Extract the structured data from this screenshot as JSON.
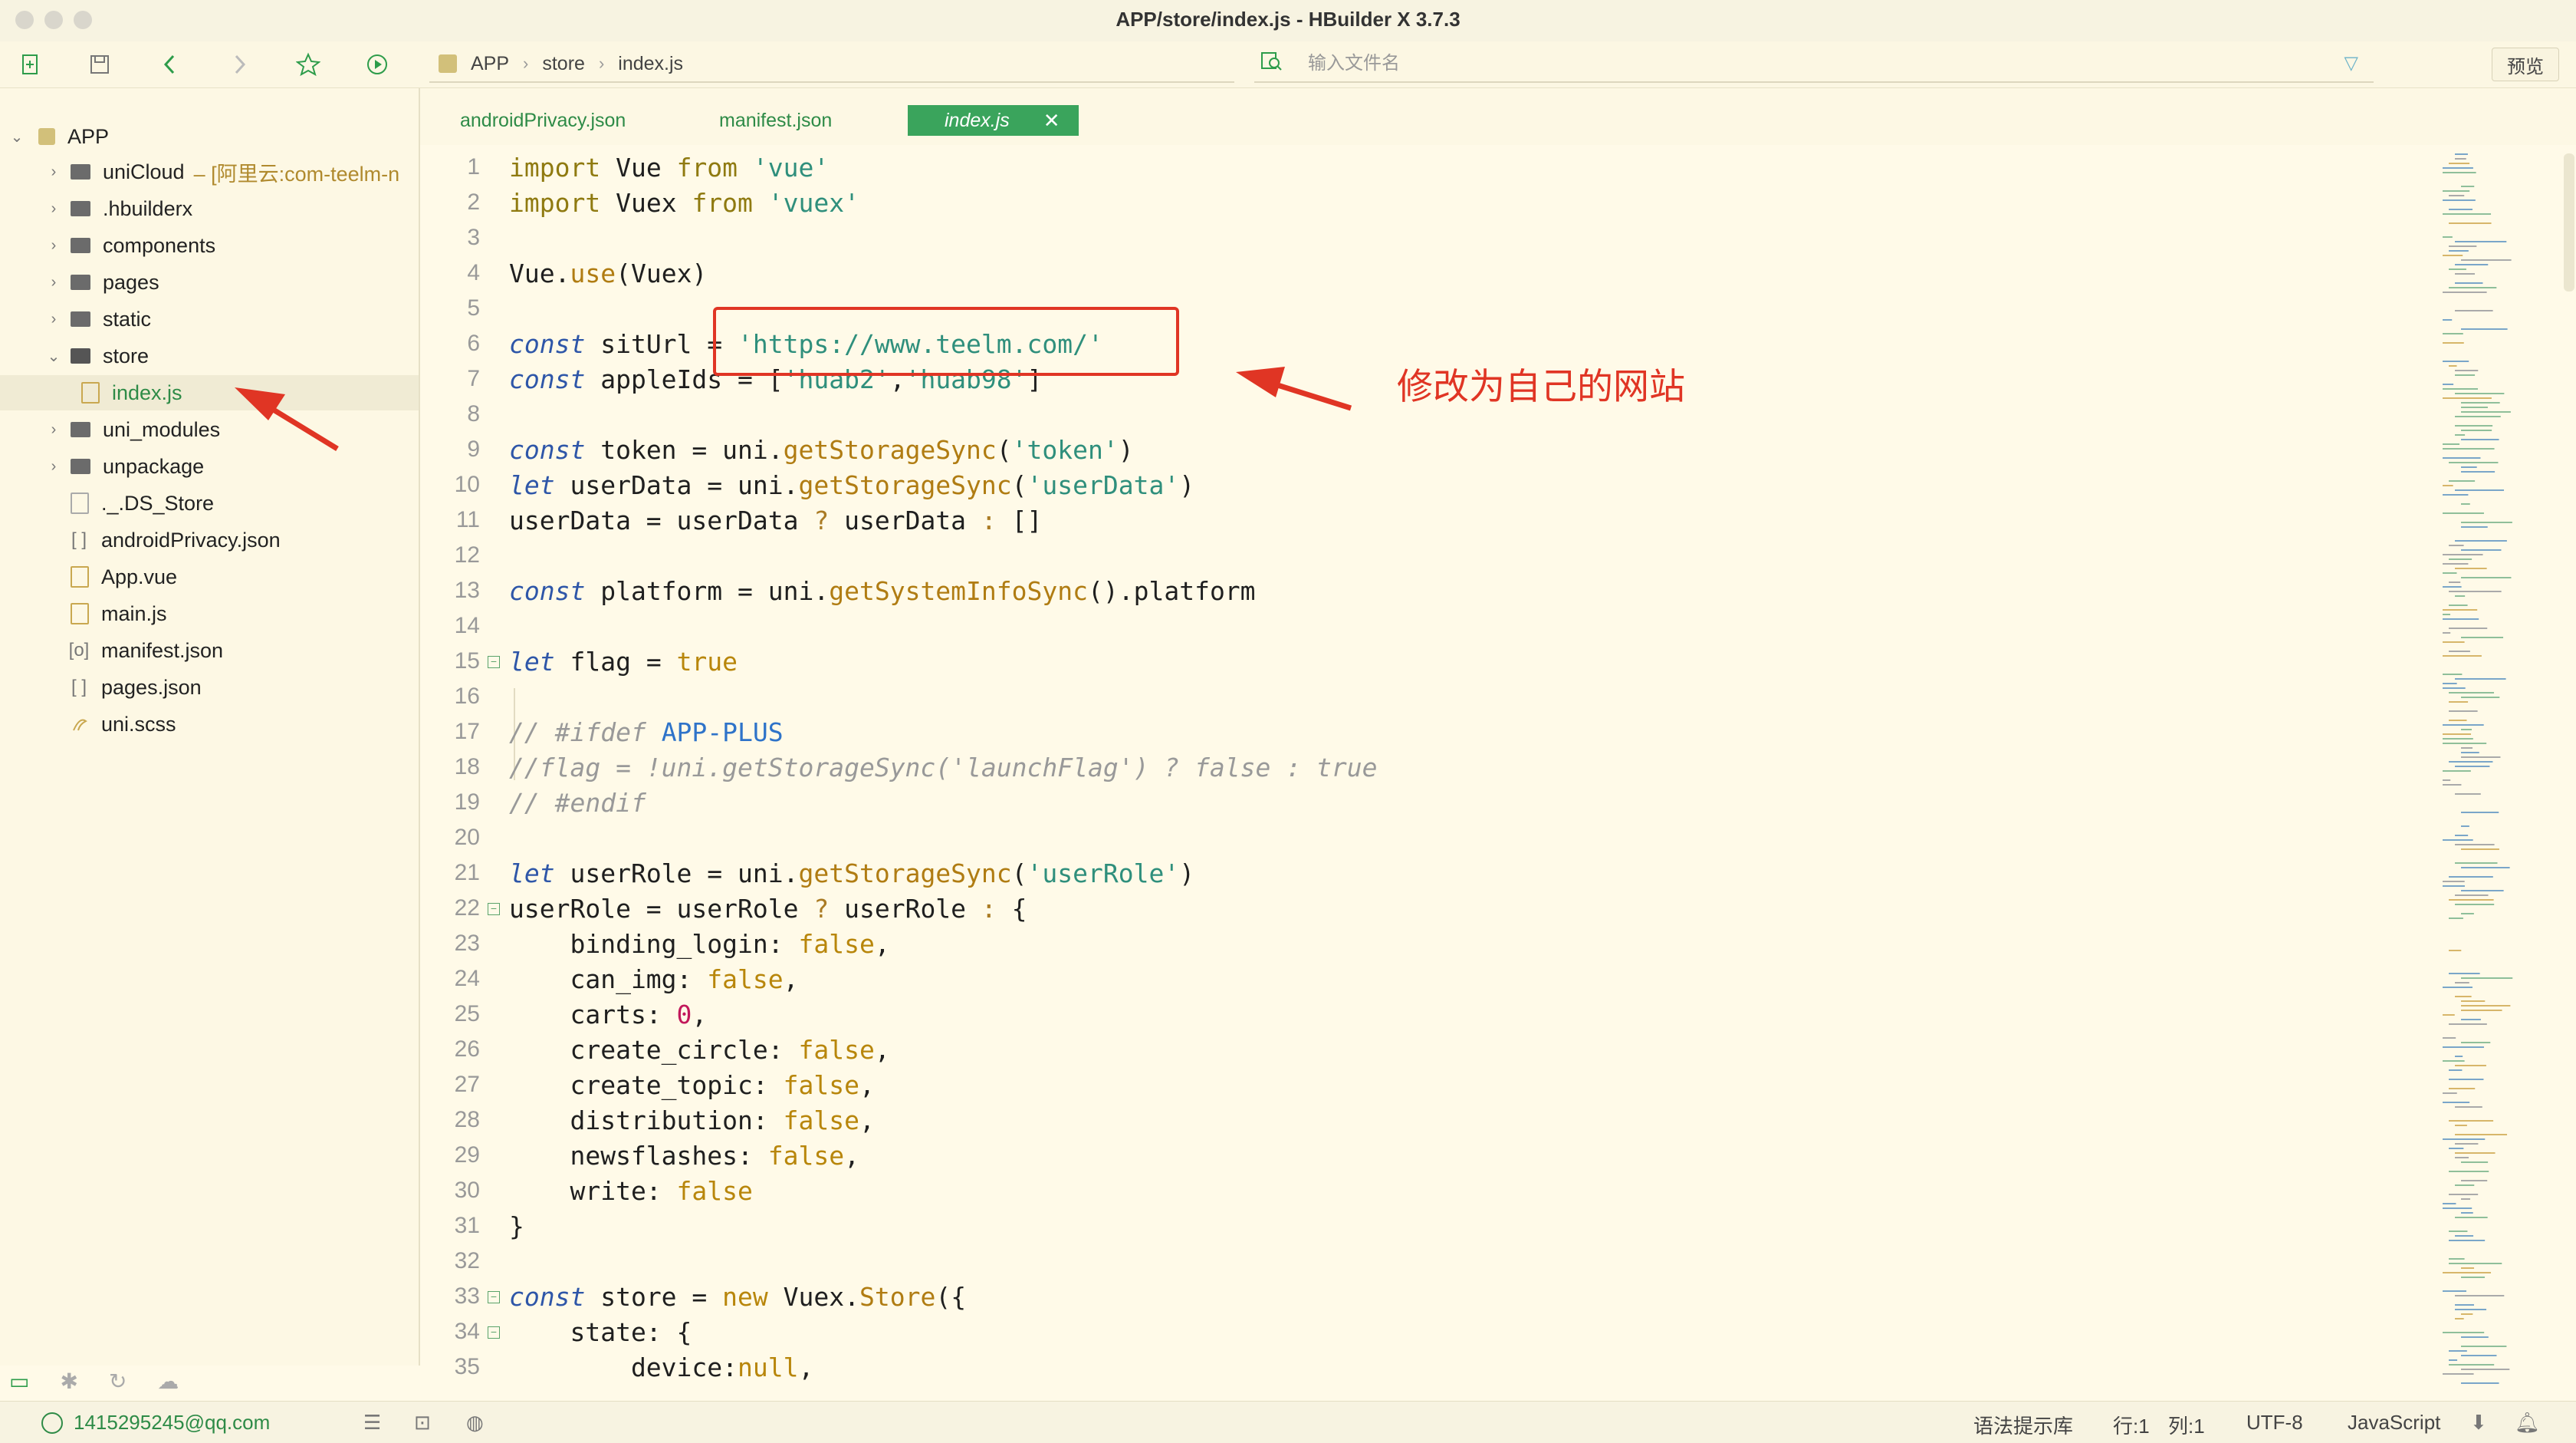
{
  "window": {
    "title": "APP/store/index.js - HBuilder X 3.7.3"
  },
  "toolbar": {
    "icons": [
      "new-file-icon",
      "save-icon",
      "back-icon",
      "forward-icon",
      "star-icon",
      "run-icon"
    ],
    "breadcrumb": [
      "APP",
      "store",
      "index.js"
    ],
    "file_search_placeholder": "输入文件名",
    "preview_label": "预览"
  },
  "sidebar": {
    "root": "APP",
    "items": [
      {
        "label": "uniCloud",
        "note": "– [阿里云:com-teelm-n",
        "type": "folder"
      },
      {
        "label": ".hbuilderx",
        "type": "folder"
      },
      {
        "label": "components",
        "type": "folder"
      },
      {
        "label": "pages",
        "type": "folder"
      },
      {
        "label": "static",
        "type": "folder"
      },
      {
        "label": "store",
        "type": "folder-open"
      },
      {
        "label": "index.js",
        "type": "file",
        "selected": true
      },
      {
        "label": "uni_modules",
        "type": "folder"
      },
      {
        "label": "unpackage",
        "type": "folder"
      },
      {
        "label": "._.DS_Store",
        "type": "file-gray"
      },
      {
        "label": "androidPrivacy.json",
        "type": "json"
      },
      {
        "label": "App.vue",
        "type": "file"
      },
      {
        "label": "main.js",
        "type": "file"
      },
      {
        "label": "manifest.json",
        "type": "json-config"
      },
      {
        "label": "pages.json",
        "type": "json"
      },
      {
        "label": "uni.scss",
        "type": "scss"
      }
    ]
  },
  "tabs": [
    {
      "label": "androidPrivacy.json",
      "active": false
    },
    {
      "label": "manifest.json",
      "active": false
    },
    {
      "label": "index.js",
      "active": true
    }
  ],
  "code_lines": [
    "1",
    "2",
    "3",
    "4",
    "5",
    "6",
    "7",
    "8",
    "9",
    "10",
    "11",
    "12",
    "13",
    "14",
    "15",
    "16",
    "17",
    "18",
    "19",
    "20",
    "21",
    "22",
    "23",
    "24",
    "25",
    "26",
    "27",
    "28",
    "29",
    "30",
    "31",
    "32",
    "33",
    "34",
    "35"
  ],
  "code": {
    "l1a": "import",
    "l1b": " Vue ",
    "l1c": "from",
    "l1d": "'vue'",
    "l2a": "import",
    "l2b": " Vuex ",
    "l2c": "from",
    "l2d": "'vuex'",
    "l4a": "Vue.",
    "l4b": "use",
    "l4c": "(Vuex)",
    "l6a": "const",
    "l6b": " sitUrl = ",
    "l6c": "'https://www.teelm.com/'",
    "l7a": "const",
    "l7b": " appleIds = [",
    "l7c": "'huab2'",
    "l7d": ",",
    "l7e": "'huab98'",
    "l7f": "]",
    "l9a": "const",
    "l9b": " token = uni.",
    "l9c": "getStorageSync",
    "l9d": "(",
    "l9e": "'token'",
    "l9f": ")",
    "l10a": "let",
    "l10b": " userData = uni.",
    "l10c": "getStorageSync",
    "l10d": "(",
    "l10e": "'userData'",
    "l10f": ")",
    "l11a": "userData = userData ",
    "l11b": "?",
    "l11c": " userData ",
    "l11d": ":",
    "l11e": " []",
    "l13a": "const",
    "l13b": " platform = uni.",
    "l13c": "getSystemInfoSync",
    "l13d": "().platform",
    "l15a": "let",
    "l15b": " flag = ",
    "l15c": "true",
    "l17a": "// #ifdef ",
    "l17b": "APP-PLUS",
    "l18": "//flag = !uni.getStorageSync('launchFlag') ? false : true",
    "l19": "// #endif",
    "l21a": "let",
    "l21b": " userRole = uni.",
    "l21c": "getStorageSync",
    "l21d": "(",
    "l21e": "'userRole'",
    "l21f": ")",
    "l22a": "userRole = userRole ",
    "l22b": "?",
    "l22c": " userRole ",
    "l22d": ":",
    "l22e": " {",
    "l23a": "    binding_login: ",
    "l23b": "false",
    "l23c": ",",
    "l24a": "    can_img: ",
    "l24b": "false",
    "l24c": ",",
    "l25a": "    carts: ",
    "l25b": "0",
    "l25c": ",",
    "l26a": "    create_circle: ",
    "l26b": "false",
    "l26c": ",",
    "l27a": "    create_topic: ",
    "l27b": "false",
    "l27c": ",",
    "l28a": "    distribution: ",
    "l28b": "false",
    "l28c": ",",
    "l29a": "    newsflashes: ",
    "l29b": "false",
    "l29c": ",",
    "l30a": "    write: ",
    "l30b": "false",
    "l31": "}",
    "l33a": "const",
    "l33b": " store = ",
    "l33c": "new",
    "l33d": " Vuex.",
    "l33e": "Store",
    "l33f": "({",
    "l34": "    state: {",
    "l35a": "        device:",
    "l35b": "null",
    "l35c": ","
  },
  "annotation": {
    "text": "修改为自己的网站"
  },
  "status": {
    "user": "1415295245@qq.com",
    "syntax": "语法提示库",
    "row": "行:1",
    "col": "列:1",
    "encoding": "UTF-8",
    "language": "JavaScript"
  },
  "colors": {
    "accent": "#3aa45c",
    "annotation": "#e03524",
    "background": "#fffae8"
  }
}
